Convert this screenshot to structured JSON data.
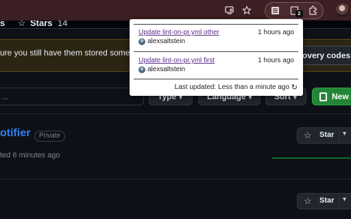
{
  "browser": {
    "badge_count": "2",
    "icons": [
      "install-app-icon",
      "bookmark-star-icon",
      "extension-list-icon",
      "notifier-extension-icon",
      "puzzle-extensions-icon",
      "profile-avatar"
    ]
  },
  "tabs": {
    "left_fragment": "s",
    "stars_label": "Stars",
    "stars_count": "14"
  },
  "banner": {
    "text": "ure you still have them stored somew",
    "button_label": "overy codes"
  },
  "filters": {
    "search_placeholder": "...",
    "type_label": "Type ▾",
    "language_label": "Language ▾",
    "sort_label": "Sort ▾",
    "new_label": "New"
  },
  "repos": [
    {
      "name": "otifier",
      "visibility": "Private",
      "updated": "ted 6 minutes ago",
      "star_label": "Star"
    },
    {
      "star_label": "Star"
    }
  ],
  "popup": {
    "items": [
      {
        "title": "Update lint-on-pr.yml other",
        "time": "1 hours ago",
        "user": "alexsaltstein"
      },
      {
        "title": "Update lint-on-pr.yml first",
        "time": "1 hours ago",
        "user": "alexsaltstein"
      }
    ],
    "footer": "Last updated: Less than a minute ago"
  },
  "colors": {
    "toolbar": "#3c1f22",
    "page_bg": "#0d1117",
    "link_blue": "#2f81f7",
    "new_button_green": "#238636",
    "popup_link": "#5b2a86"
  }
}
